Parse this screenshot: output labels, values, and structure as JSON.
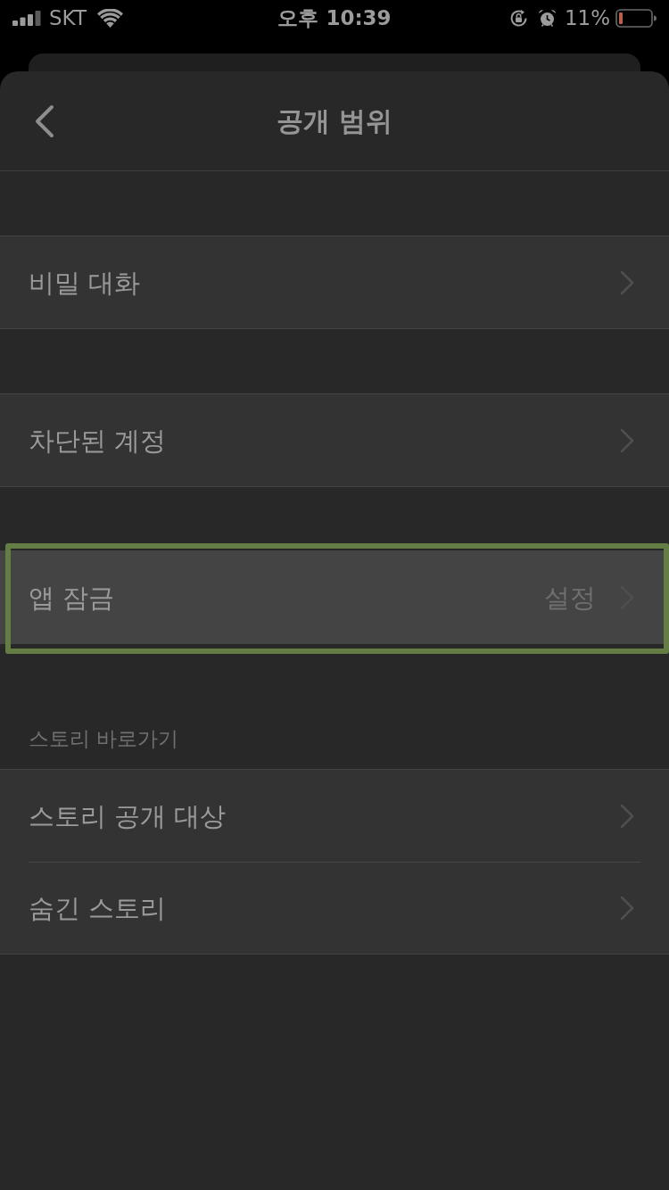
{
  "status_bar": {
    "carrier": "SKT",
    "time": "오후 10:39",
    "battery_percent": "11%"
  },
  "header": {
    "title": "공개 범위"
  },
  "groups": [
    {
      "items": [
        {
          "label": "비밀 대화",
          "highlighted": false
        }
      ]
    },
    {
      "items": [
        {
          "label": "차단된 계정",
          "highlighted": false
        }
      ]
    },
    {
      "items": [
        {
          "label": "앱 잠금",
          "value": "설정",
          "highlighted": true
        }
      ]
    },
    {
      "label": "스토리 바로가기",
      "items": [
        {
          "label": "스토리 공개 대상",
          "highlighted": false
        },
        {
          "label": "숨긴 스토리",
          "highlighted": false
        }
      ]
    }
  ]
}
